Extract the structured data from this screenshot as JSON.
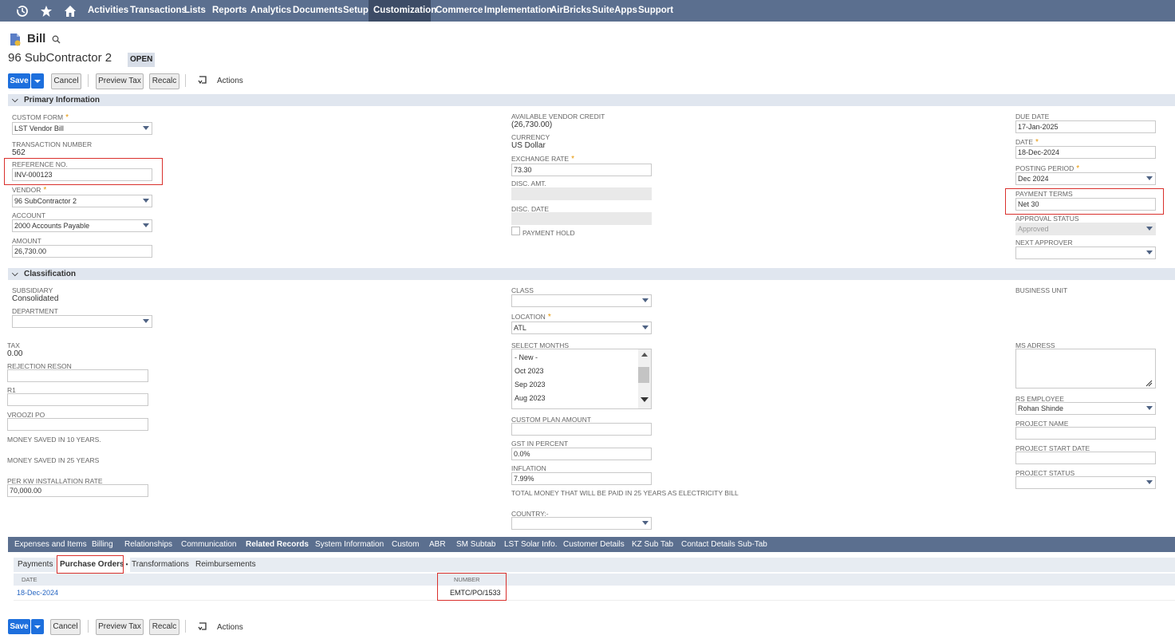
{
  "nav": {
    "items": [
      "Activities",
      "Transactions",
      "Lists",
      "Reports",
      "Analytics",
      "Documents",
      "Setup",
      "Customization",
      "Commerce",
      "Implementation",
      "AirBricks",
      "SuiteApps",
      "Support"
    ],
    "active": "Customization",
    "icons": [
      "recent-records-icon",
      "favorites-star-icon",
      "home-icon"
    ],
    "bar_color": "#5b6f8f",
    "active_color": "#3d4c66"
  },
  "header": {
    "page_title": "Bill",
    "record_name": "96 SubContractor 2",
    "status": "OPEN"
  },
  "toolbar": {
    "save": "Save",
    "cancel": "Cancel",
    "preview_tax": "Preview Tax",
    "recalc": "Recalc",
    "actions": "Actions",
    "save_color": "#1d6fdd"
  },
  "sections": {
    "primary": "Primary Information",
    "classification": "Classification"
  },
  "primary": {
    "custom_form": {
      "label": "CUSTOM FORM",
      "value": "LST Vendor Bill"
    },
    "transaction_number": {
      "label": "TRANSACTION NUMBER",
      "value": "562"
    },
    "reference_no": {
      "label": "REFERENCE NO.",
      "value": "INV-000123"
    },
    "vendor": {
      "label": "VENDOR",
      "value": "96 SubContractor 2"
    },
    "account": {
      "label": "ACCOUNT",
      "value": "2000 Accounts Payable"
    },
    "amount": {
      "label": "AMOUNT",
      "value": "26,730.00"
    },
    "available_vendor_credit": {
      "label": "AVAILABLE VENDOR CREDIT",
      "value": "(26,730.00)"
    },
    "currency": {
      "label": "CURRENCY",
      "value": "US Dollar"
    },
    "exchange_rate": {
      "label": "EXCHANGE RATE",
      "value": "73.30"
    },
    "disc_amt": {
      "label": "DISC. AMT.",
      "value": ""
    },
    "disc_date": {
      "label": "DISC. DATE",
      "value": ""
    },
    "payment_hold": {
      "label": "PAYMENT HOLD"
    },
    "due_date": {
      "label": "DUE DATE",
      "value": "17-Jan-2025"
    },
    "date": {
      "label": "DATE",
      "value": "18-Dec-2024"
    },
    "posting_period": {
      "label": "POSTING PERIOD",
      "value": "Dec 2024"
    },
    "payment_terms": {
      "label": "PAYMENT TERMS",
      "value": "Net 30"
    },
    "approval_status": {
      "label": "APPROVAL STATUS",
      "value": "Approved"
    },
    "next_approver": {
      "label": "NEXT APPROVER",
      "value": ""
    }
  },
  "classification": {
    "subsidiary": {
      "label": "SUBSIDIARY",
      "value": "Consolidated"
    },
    "department": {
      "label": "DEPARTMENT",
      "value": ""
    },
    "class": {
      "label": "CLASS",
      "value": ""
    },
    "location": {
      "label": "LOCATION",
      "value": "ATL"
    },
    "business_unit": {
      "label": "BUSINESS UNIT"
    },
    "tax": {
      "label": "TAX",
      "value": "0.00"
    },
    "rejection_reson": {
      "label": "REJECTION RESON",
      "value": ""
    },
    "r1": {
      "label": "R1",
      "value": ""
    },
    "vroozi_po": {
      "label": "VROOZI PO",
      "value": ""
    },
    "money_saved_10": {
      "label": "MONEY SAVED IN 10 YEARS."
    },
    "money_saved_25": {
      "label": "MONEY SAVED IN 25 YEARS"
    },
    "per_kw_rate": {
      "label": "PER KW INSTALLATION RATE",
      "value": "70,000.00"
    },
    "select_months": {
      "label": "SELECT MONTHS",
      "options": [
        "- New -",
        "Oct 2023",
        "Sep 2023",
        "Aug 2023"
      ]
    },
    "custom_plan_amount": {
      "label": "CUSTOM PLAN AMOUNT",
      "value": ""
    },
    "gst_in_percent": {
      "label": "GST IN PERCENT",
      "value": "0.0%"
    },
    "inflation": {
      "label": "INFLATION",
      "value": "7.99%"
    },
    "total_money": {
      "label": "TOTAL MONEY THAT WILL BE PAID IN 25 YEARS AS ELECTRICITY BILL"
    },
    "country": {
      "label": "COUNTRY:-",
      "value": ""
    },
    "ms_adress": {
      "label": "MS ADRESS",
      "value": ""
    },
    "rs_employee": {
      "label": "RS EMPLOYEE",
      "value": "Rohan Shinde"
    },
    "project_name": {
      "label": "PROJECT NAME",
      "value": ""
    },
    "project_start_date": {
      "label": "PROJECT START DATE",
      "value": ""
    },
    "project_status": {
      "label": "PROJECT STATUS",
      "value": ""
    }
  },
  "tabs": {
    "items": [
      "Expenses and Items",
      "Billing",
      "Relationships",
      "Communication",
      "Related Records",
      "System Information",
      "Custom",
      "ABR",
      "SM Subtab",
      "LST Solar Info.",
      "Customer Details",
      "KZ Sub Tab",
      "Contact Details Sub-Tab"
    ],
    "active": "Related Records"
  },
  "subtabs": {
    "items": [
      "Payments",
      "Purchase Orders",
      "Transformations",
      "Reimbursements"
    ],
    "active": "Purchase Orders",
    "active_suffix": "•"
  },
  "grid": {
    "columns": [
      "DATE",
      "NUMBER"
    ],
    "rows": [
      {
        "date": "18-Dec-2024",
        "number": "EMTC/PO/1533"
      }
    ]
  }
}
